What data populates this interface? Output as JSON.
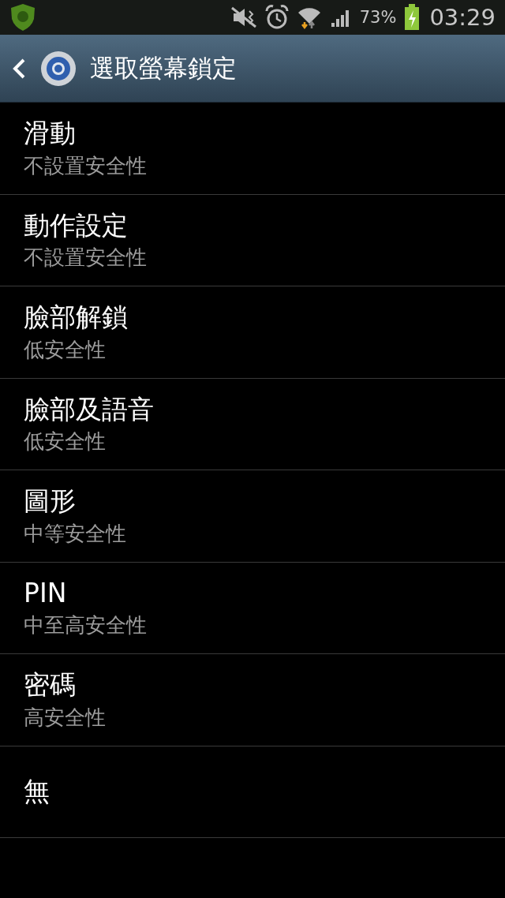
{
  "status_bar": {
    "battery_text": "73%",
    "time": "03:29"
  },
  "header": {
    "title": "選取螢幕鎖定"
  },
  "options": [
    {
      "title": "滑動",
      "subtitle": "不設置安全性"
    },
    {
      "title": "動作設定",
      "subtitle": "不設置安全性"
    },
    {
      "title": "臉部解鎖",
      "subtitle": "低安全性"
    },
    {
      "title": "臉部及語音",
      "subtitle": "低安全性"
    },
    {
      "title": "圖形",
      "subtitle": "中等安全性"
    },
    {
      "title": "PIN",
      "subtitle": "中至高安全性"
    },
    {
      "title": "密碼",
      "subtitle": "高安全性"
    },
    {
      "title": "無"
    }
  ]
}
